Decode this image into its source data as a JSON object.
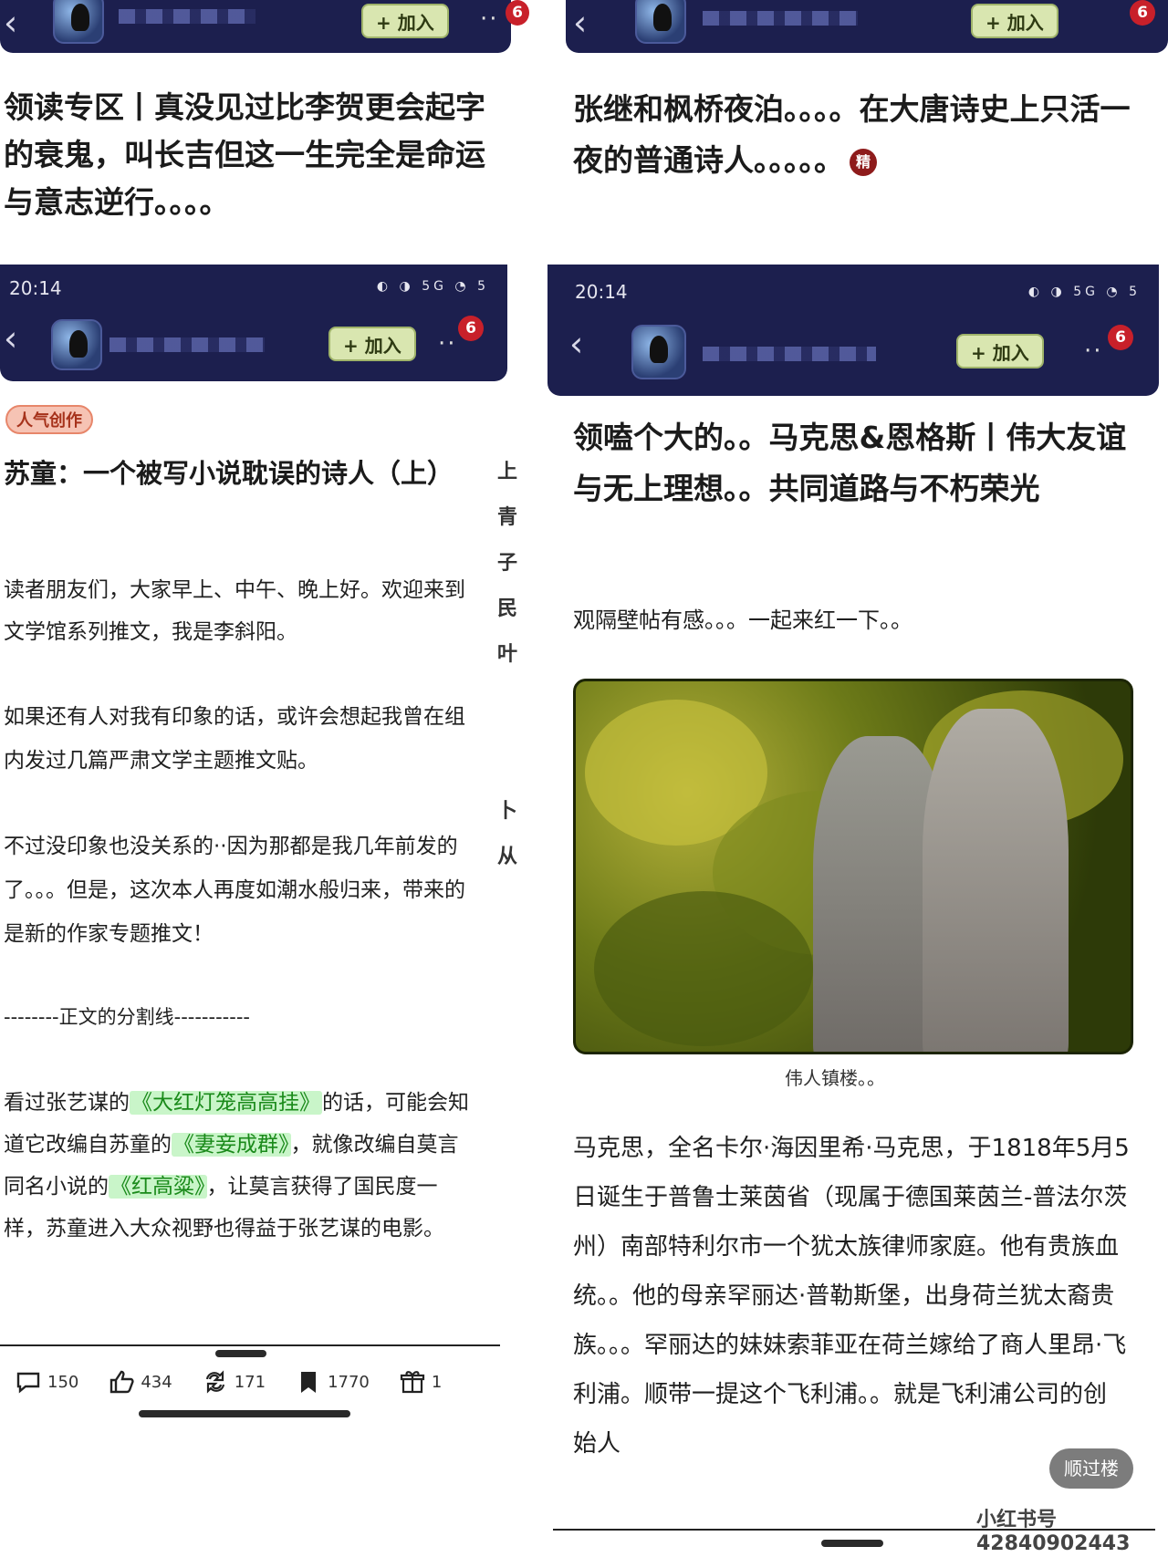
{
  "left": {
    "top_bar": {
      "join_label": "+ 加入",
      "more": "··",
      "badge": "6"
    },
    "post1_title": "领读专区丨真没见过比李贺更会起字的衰鬼，叫长吉但这一生完全是命运与意志逆行。。。。",
    "bar2": {
      "time": "20:14",
      "status_icons": "◐ ◑ 5G ◔ 5",
      "join_label": "+ 加入",
      "more": "··",
      "badge": "6"
    },
    "tag_hot": "人气创作",
    "post2_title": "苏童：一个被写小说耽误的诗人（上）",
    "p1": "读者朋友们，大家早上、中午、晚上好。欢迎来到文学馆系列推文，我是李斜阳。",
    "p2": "如果还有人对我有印象的话，或许会想起我曾在组内发过几篇严肃文学主题推文贴。",
    "p3": "不过没印象也没关系的··因为那都是我几年前发的了。。。但是，这次本人再度如潮水般归来，带来的是新的作家专题推文！",
    "divider": "--------正文的分割线-----------",
    "p4_a": "看过张艺谋的",
    "p4_hl1": "《大红灯笼高高挂》",
    "p4_b": "的话，可能会知道它改编自苏童的",
    "p4_hl2": "《妻妾成群》",
    "p4_c": "，就像改编自莫言同名小说的",
    "p4_hl3": "《红高粱》",
    "p4_d": "，让莫言获得了国民度一样，苏童进入大众视野也得益于张艺谋的电影。",
    "vertical_chars": [
      "上",
      "青",
      "子",
      "民",
      "叶",
      "",
      "",
      "卜",
      "从"
    ],
    "actions": {
      "comments": "150",
      "likes": "434",
      "shares": "171",
      "favorites": "1770",
      "gifts": "1"
    }
  },
  "right": {
    "top_bar": {
      "join_label": "+ 加入",
      "badge": "6"
    },
    "post1_title": "张继和枫桥夜泊。。。。在大唐诗史上只活一夜的普通诗人。。。。。",
    "tag_jing": "精",
    "bar2": {
      "time": "20:14",
      "status_icons": "◐ ◑ 5G ◔ 5",
      "join_label": "+ 加入",
      "more": "··",
      "badge": "6"
    },
    "post2_title": "领嗑个大的。。马克思&恩格斯丨伟大友谊与无上理想。。共同道路与不朽荣光",
    "intro": "观隔壁帖有感。。。一起来红一下。。",
    "caption": "伟人镇楼。。",
    "body": "马克思，全名卡尔·海因里希·马克思，于1818年5月5日诞生于普鲁士莱茵省（现属于德国莱茵兰-普法尔茨州）南部特利尔市一个犹太族律师家庭。他有贵族血统。。他的母亲罕丽达·普勒斯堡，出身荷兰犹太裔贵族。。。罕丽达的妹妹索菲亚在荷兰嫁给了商人里昂·飞利浦。顺带一提这个飞利浦。。就是飞利浦公司的创始人",
    "float_button": "顺过楼",
    "watermark": "小红书号 42840902443"
  },
  "colors": {
    "navbar": "#1c1f4e",
    "join": "#d9e6b0",
    "badge": "#c8202a",
    "highlight": "#1a8a1a",
    "hot_tag": "#f6c3b4"
  }
}
